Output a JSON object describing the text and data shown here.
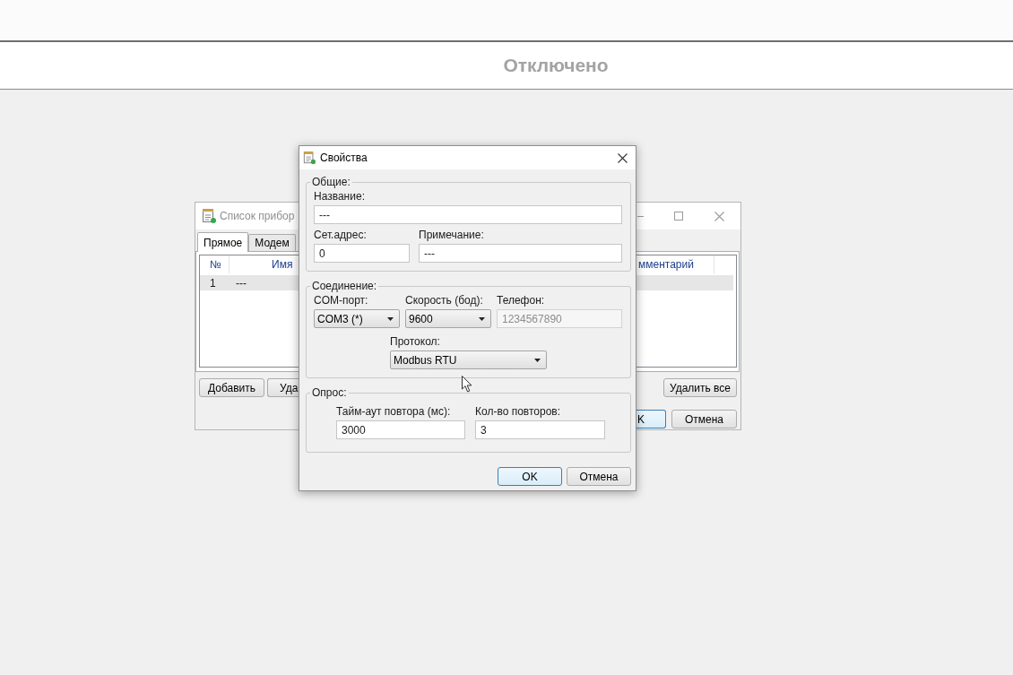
{
  "status": {
    "text": "Отключено"
  },
  "device_list_window": {
    "title": "Список прибор",
    "tabs": [
      {
        "label": "Прямое",
        "selected": true
      },
      {
        "label": "Модем",
        "selected": false
      }
    ],
    "left_part": {
      "columns": [
        "№",
        "Имя"
      ],
      "rows": [
        {
          "cells": [
            "1",
            "---"
          ],
          "selected": true
        }
      ],
      "buttons": [
        {
          "label": "Добавить"
        },
        {
          "label": "Уда"
        }
      ]
    },
    "right_part": {
      "columns": [
        "мментарий"
      ],
      "rows": [
        {
          "selected": true
        }
      ],
      "buttons": [
        {
          "label": "Удалить все"
        }
      ],
      "dialog_buttons": [
        {
          "label": "K",
          "default": true
        },
        {
          "label": "Отмена",
          "default": false
        }
      ]
    }
  },
  "properties_dialog": {
    "title": "Свойства",
    "groups": [
      {
        "title": "Общие:",
        "rows": [
          {
            "fields": [
              {
                "label": "Название:",
                "value": "---",
                "kind": "text",
                "disabled": false
              }
            ]
          },
          {
            "fields": [
              {
                "label": "Сет.адрес:",
                "value": "0",
                "kind": "text",
                "disabled": false
              },
              {
                "label": "Примечание:",
                "value": "---",
                "kind": "text",
                "disabled": false
              }
            ]
          }
        ]
      },
      {
        "title": "Соединение:",
        "rows": [
          {
            "fields": [
              {
                "label": "COM-порт:",
                "value": "COM3 (*)",
                "kind": "combo",
                "disabled": false
              },
              {
                "label": "Скорость (бод):",
                "value": "9600",
                "kind": "combo",
                "disabled": false
              },
              {
                "label": "Телефон:",
                "value": "1234567890",
                "kind": "text",
                "disabled": true
              }
            ]
          },
          {
            "fields": [
              {
                "label": "Протокол:",
                "value": "Modbus RTU",
                "kind": "combo",
                "disabled": false
              }
            ]
          }
        ]
      },
      {
        "title": "Опрос:",
        "rows": [
          {
            "fields": [
              {
                "label": "Тайм-аут повтора (мс):",
                "value": "3000",
                "kind": "text",
                "disabled": false
              },
              {
                "label": "Кол-во повторов:",
                "value": "3",
                "kind": "text",
                "disabled": false
              }
            ]
          }
        ]
      }
    ],
    "buttons": [
      {
        "label": "OK",
        "default": true
      },
      {
        "label": "Отмена",
        "default": false
      }
    ]
  }
}
